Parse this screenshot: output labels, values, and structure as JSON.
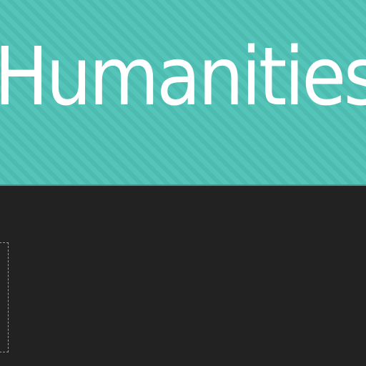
{
  "slide": {
    "title": "Humanities",
    "colors": {
      "banner": "#56c5b9",
      "background": "#222222",
      "title_text": "#ffffff"
    }
  }
}
